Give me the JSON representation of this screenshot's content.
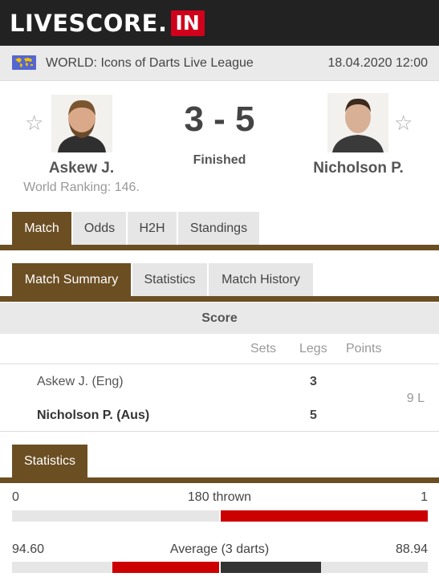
{
  "header": {
    "logo_text": "LIVESCORE.",
    "logo_suffix": "IN"
  },
  "league": {
    "name": "WORLD: Icons of Darts Live League",
    "datetime": "18.04.2020 12:00",
    "flag_icon": "world-flag-icon"
  },
  "match": {
    "home": {
      "name": "Askew J.",
      "ranking": "World Ranking: 146."
    },
    "away": {
      "name": "Nicholson P."
    },
    "score": "3 - 5",
    "status": "Finished"
  },
  "tabs": [
    {
      "label": "Match",
      "active": true
    },
    {
      "label": "Odds",
      "active": false
    },
    {
      "label": "H2H",
      "active": false
    },
    {
      "label": "Standings",
      "active": false
    }
  ],
  "subtabs": [
    {
      "label": "Match Summary",
      "active": true
    },
    {
      "label": "Statistics",
      "active": false
    },
    {
      "label": "Match History",
      "active": false
    }
  ],
  "score_section": {
    "title": "Score",
    "columns": [
      "Sets",
      "Legs",
      "Points"
    ],
    "rows": [
      {
        "player": "Askew J. (Eng)",
        "legs": "3",
        "winner": false
      },
      {
        "player": "Nicholson P. (Aus)",
        "legs": "5",
        "winner": true
      }
    ],
    "points": "9 L"
  },
  "statistics": {
    "tab_label": "Statistics",
    "items": [
      {
        "label": "180 thrown",
        "home": "0",
        "away": "1",
        "home_share": 0.0,
        "away_share": 1.0
      },
      {
        "label": "Average (3 darts)",
        "home": "94.60",
        "away": "88.94",
        "home_share": 0.515,
        "away_share": 0.485
      }
    ]
  },
  "colors": {
    "accent": "#6b4e22",
    "dark": "#222222",
    "home_bar": "#cc0000",
    "away_bar": "#333333",
    "bar_bg": "#e6e6e6"
  }
}
